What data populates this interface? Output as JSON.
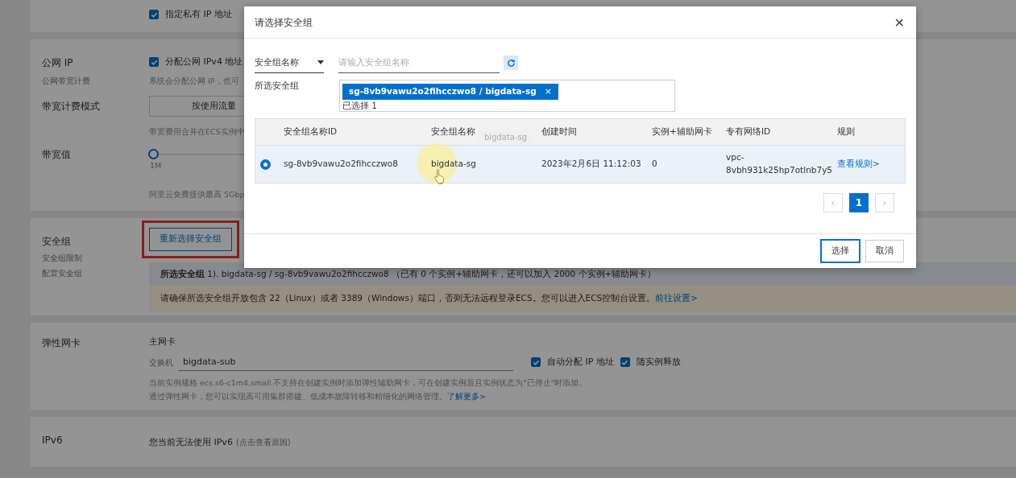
{
  "background": {
    "private_ip": {
      "label": "指定私有 IP 地址",
      "checked": true
    },
    "public_ip": {
      "title": "公网 IP",
      "subtitle": "公网带宽计费",
      "checkbox": {
        "label": "分配公网 IPv4 地址",
        "checked": true
      },
      "note": "系统会分配公网 IP，也可",
      "billing_label": "带宽计费模式",
      "billing_option": "按使用流量",
      "billing_note": "带宽费用合并在ECS实例中",
      "bandwidth_label": "带宽值",
      "bandwidth": {
        "level": 0,
        "reading": "1M"
      },
      "bandwidth_note": "阿里云免费提供最高 5Gbp"
    },
    "security_group": {
      "title": "安全组",
      "links": [
        "安全组限制",
        "配置安全组"
      ],
      "button": {
        "label": "重新选择安全组",
        "highlighted": true
      },
      "summary": "**所选安全组** 1). bigdata-sg / sg-8vb9vawu2o2fihcczwo8 （已有 0 个实例+辅助网卡，还可以加入 2000 个实例+辅助网卡）",
      "warning": "请确保所选安全组开放包含 22（Linux）或者 3389（Windows）端口，否则无法远程登录ECS。您可以进入ECS控制台设置。",
      "warning_link": "前往设置>"
    },
    "eni": {
      "title": "弹性网卡",
      "subtitle": "主网卡",
      "switch_label": "交换机",
      "switch_value": "bigdata-sub",
      "options": [
        {
          "label": "自动分配 IP 地址",
          "checked": true
        },
        {
          "label": "随实例释放",
          "checked": true
        }
      ],
      "note": "当前实例规格 ecs.s6-c1m4.small 不支持在创建实例时添加弹性辅助网卡，可在创建实例后且实例状态为\"已停止\"时添加。",
      "note2": "通过弹性网卡，您可以实现高可用集群搭建、低成本故障转移和精细化的网络管理。",
      "note2_link": "了解更多>"
    },
    "ipv6": {
      "title": "IPv6",
      "text": "您当前无法使用 IPv6",
      "hint": "(点击查看原因)"
    }
  },
  "modal": {
    "title": "请选择安全组",
    "close": "×",
    "filter": {
      "field": "安全组名称",
      "placeholder": "请输入安全组名称"
    },
    "selected_label": "所选安全组",
    "selected_tags": [
      {
        "text": "sg-8vb9vawu2o2fihcczwo8 / bigdata-sg",
        "remove": "×"
      }
    ],
    "selected_count": "已选择 1",
    "table": {
      "columns": [
        "安全组名称ID",
        "安全组名称",
        "创建时间",
        "实例+辅助网卡",
        "专有网络ID",
        "规则"
      ],
      "rows": [
        {
          "selected": true,
          "id": "sg-8vb9vawu2o2fihcczwo8",
          "name": "bigdata-sg",
          "created": "2023年2月6日 11:12:03",
          "count": "0",
          "vpc": [
            "vpc-",
            "8vbh931k25hp7otlnb7y5"
          ],
          "rule": "查看规则>"
        }
      ]
    },
    "tooltip": "bigdata-sg",
    "pagination": {
      "prev": "‹",
      "pages": [
        {
          "label": "1",
          "selected": true
        }
      ],
      "next": "›"
    },
    "buttons": [
      {
        "label": "选择",
        "primary": true
      },
      {
        "label": "取消",
        "primary": false
      }
    ]
  }
}
